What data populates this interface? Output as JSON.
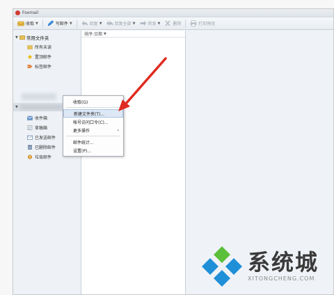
{
  "window": {
    "title": "Foxmail"
  },
  "toolbar": {
    "items": [
      {
        "label": "收取",
        "icon": "inbox-receive-icon",
        "dropdown": true,
        "enabled": true
      },
      {
        "label": "写邮件",
        "icon": "pen-compose-icon",
        "dropdown": true,
        "enabled": true
      },
      {
        "label": "回复",
        "icon": "reply-icon",
        "dropdown": true,
        "enabled": false
      },
      {
        "label": "回复全部",
        "icon": "reply-all-icon",
        "dropdown": true,
        "enabled": false
      },
      {
        "label": "转发",
        "icon": "forward-icon",
        "dropdown": true,
        "enabled": false
      },
      {
        "label": "删除",
        "icon": "delete-x-icon",
        "dropdown": false,
        "enabled": false
      },
      {
        "label": "打印预览",
        "icon": "printer-icon",
        "dropdown": false,
        "enabled": false
      }
    ]
  },
  "sidebar": {
    "common_group": {
      "label": "常用文件夹",
      "items": [
        {
          "label": "所有未读",
          "icon": "folder-icon"
        },
        {
          "label": "置顶邮件",
          "icon": "star-icon"
        },
        {
          "label": "标签邮件",
          "icon": "tag-icon"
        }
      ]
    },
    "account_folders": [
      {
        "label": "收件箱",
        "icon": "inbox-icon"
      },
      {
        "label": "草稿箱",
        "icon": "draft-icon"
      },
      {
        "label": "已发送邮件",
        "icon": "sent-icon"
      },
      {
        "label": "已删除邮件",
        "icon": "trash-icon"
      },
      {
        "label": "垃圾邮件",
        "icon": "spam-icon"
      }
    ]
  },
  "list_pane": {
    "sort_label": "排序:日期"
  },
  "context_menu": {
    "items": [
      {
        "label": "收取(G)",
        "highlighted": false,
        "submenu": false
      },
      {
        "label": "新建文件夹(T)...",
        "highlighted": true,
        "submenu": false
      },
      {
        "label": "帐号访问口令(C)...",
        "highlighted": false,
        "submenu": false
      },
      {
        "label": "更多操作",
        "highlighted": false,
        "submenu": true
      },
      {
        "label": "邮件统计...",
        "highlighted": false,
        "submenu": false
      },
      {
        "label": "设置(P)...",
        "highlighted": false,
        "submenu": false
      }
    ]
  },
  "watermark": {
    "title": "系统城",
    "url": "XITONGCHENG.COM"
  },
  "colors": {
    "arrow": "#e02b20",
    "highlight": "#dde8f5",
    "watermark_blue": "#1f8fd8",
    "watermark_green": "#5bbf3a"
  }
}
